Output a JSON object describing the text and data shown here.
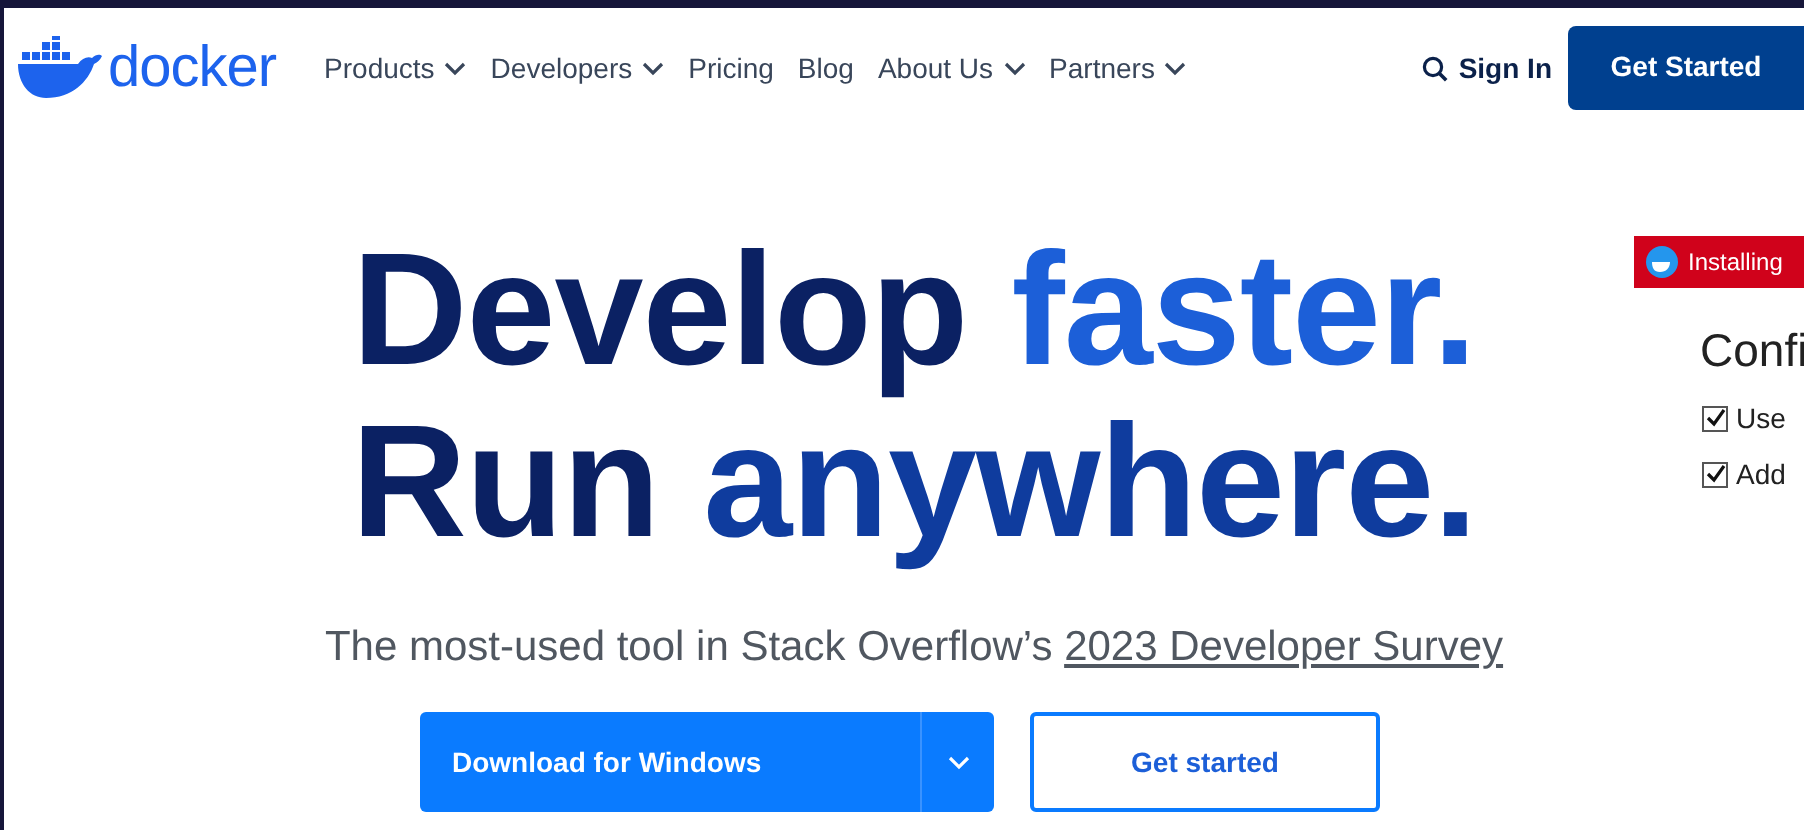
{
  "header": {
    "logo": "docker",
    "nav": [
      {
        "label": "Products",
        "dropdown": true
      },
      {
        "label": "Developers",
        "dropdown": true
      },
      {
        "label": "Pricing",
        "dropdown": false
      },
      {
        "label": "Blog",
        "dropdown": false
      },
      {
        "label": "About Us",
        "dropdown": true
      },
      {
        "label": "Partners",
        "dropdown": true
      }
    ],
    "sign_in": "Sign In",
    "cta": "Get Started"
  },
  "hero": {
    "headline": [
      [
        {
          "text": "Develop",
          "kind": "dark"
        },
        {
          "text": "faster.",
          "kind": "bright"
        }
      ],
      [
        {
          "text": "Run",
          "kind": "dark"
        },
        {
          "text": "anywhere.",
          "kind": "mid"
        }
      ]
    ],
    "subtitle": "The most-used tool in Stack Overflow’s",
    "subtitle_link": "2023 Developer Survey",
    "primary_button": "Download for Windows",
    "secondary_button": "Get started"
  },
  "installer": {
    "title": "Installing",
    "heading": "Confi",
    "options": [
      {
        "label": "Use",
        "checked": true
      },
      {
        "label": "Add",
        "checked": true
      }
    ]
  }
}
